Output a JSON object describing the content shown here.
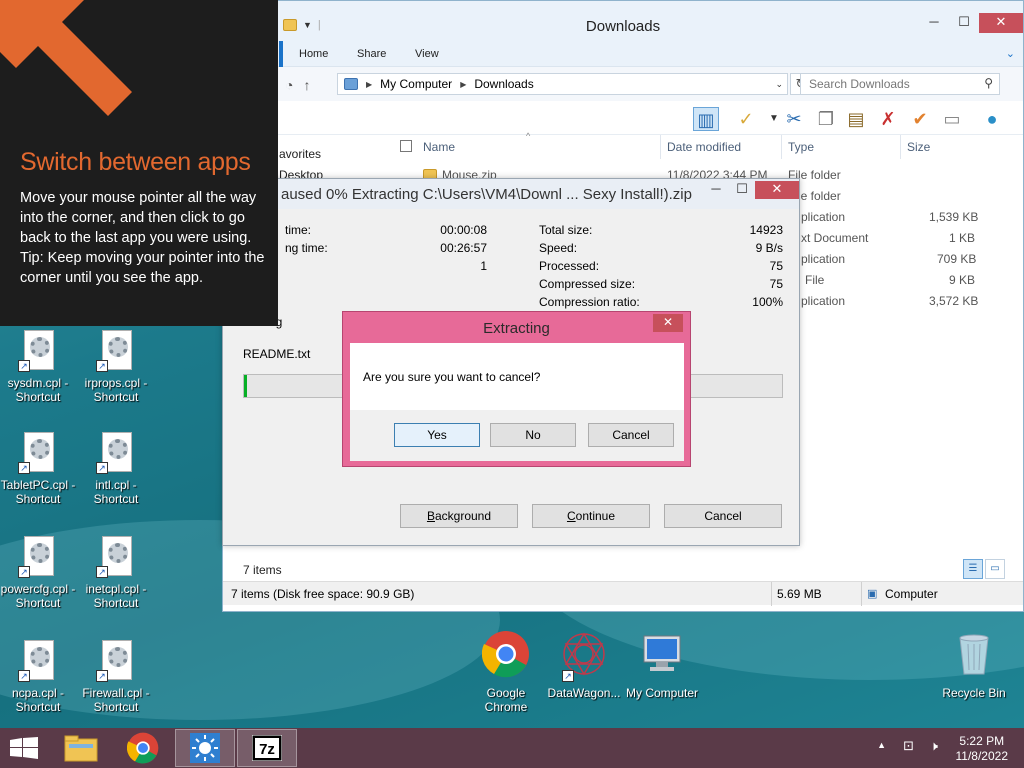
{
  "explorer": {
    "title": "Downloads",
    "tabs": [
      "Home",
      "Share",
      "View"
    ],
    "breadcrumb": [
      "My Computer",
      "Downloads"
    ],
    "search_placeholder": "Search Downloads",
    "columns": [
      "Name",
      "Date modified",
      "Type",
      "Size"
    ],
    "nav_pane": [
      "avorites",
      "Desktop"
    ],
    "rows": [
      {
        "name": "Mouse.zip",
        "date": "11/8/2022 3:44 PM",
        "type": "File folder",
        "size": ""
      },
      {
        "name": "",
        "date": "",
        "type": "File folder",
        "size": ""
      },
      {
        "name": "",
        "date": "",
        "type": "plication",
        "size": "1,539 KB"
      },
      {
        "name": "",
        "date": "",
        "type": "xt Document",
        "size": "1 KB"
      },
      {
        "name": "",
        "date": "",
        "type": "plication",
        "size": "709 KB"
      },
      {
        "name": "",
        "date": "",
        "type": "File",
        "size": "9 KB"
      },
      {
        "name": "",
        "date": "",
        "type": "plication",
        "size": "3,572 KB"
      }
    ],
    "item_count": "7 items",
    "status_left": "7 items (Disk free space: 90.9 GB)",
    "status_size": "5.69 MB",
    "status_location": "Computer"
  },
  "zip": {
    "title": "aused 0% Extracting C:\\Users\\VM4\\Downl ... Sexy Install!).zip",
    "left_stats": [
      {
        "label": "time:",
        "value": "00:00:08"
      },
      {
        "label": "ng time:",
        "value": "00:26:57"
      },
      {
        "label": "",
        "value": "1"
      }
    ],
    "right_stats": [
      {
        "label": "Total size:",
        "value": "14923"
      },
      {
        "label": "Speed:",
        "value": "9 B/s"
      },
      {
        "label": "Processed:",
        "value": "75"
      },
      {
        "label": "Compressed size:",
        "value": "75"
      },
      {
        "label": "Compression ratio:",
        "value": "100%"
      }
    ],
    "partial_label": "ng",
    "current_file": "README.txt",
    "progress": 0.005,
    "buttons": {
      "background": "Background",
      "continue": "Continue",
      "cancel": "Cancel"
    }
  },
  "confirm": {
    "title": "Extracting",
    "message": "Are you sure you want to cancel?",
    "buttons": {
      "yes": "Yes",
      "no": "No",
      "cancel": "Cancel"
    }
  },
  "tip": {
    "heading": "Switch between apps",
    "body": "Move your mouse pointer all the way into the corner, and then click to go back to the last app you were using.",
    "hint": "Tip: Keep moving your pointer into the corner until you see the app."
  },
  "desktop_icons": [
    {
      "label": "sysdm.cpl - Shortcut",
      "icon": "settings-file-icon"
    },
    {
      "label": "irprops.cpl - Shortcut",
      "icon": "settings-file-icon"
    },
    {
      "label": "TabletPC.cpl - Shortcut",
      "icon": "settings-file-icon"
    },
    {
      "label": "intl.cpl - Shortcut",
      "icon": "settings-file-icon"
    },
    {
      "label": "powercfg.cpl - Shortcut",
      "icon": "settings-file-icon"
    },
    {
      "label": "inetcpl.cpl - Shortcut",
      "icon": "settings-file-icon"
    },
    {
      "label": "ncpa.cpl - Shortcut",
      "icon": "settings-file-icon"
    },
    {
      "label": "Firewall.cpl - Shortcut",
      "icon": "settings-file-icon"
    },
    {
      "label": "Google Chrome",
      "icon": "chrome-icon"
    },
    {
      "label": "DataWagon...",
      "icon": "datawagon-icon"
    },
    {
      "label": "My Computer",
      "icon": "computer-icon"
    },
    {
      "label": "Recycle Bin",
      "icon": "recycle-bin-icon"
    }
  ],
  "taskbar": {
    "apps": [
      "file-explorer-icon",
      "chrome-icon",
      "sun-app-icon",
      "7zip-icon"
    ],
    "time": "5:22 PM",
    "date": "11/8/2022"
  },
  "colors": {
    "accent_orange": "#e2682f",
    "dialog_pink": "#e76a98",
    "close_red": "#c7505b",
    "taskbar": "#5a3a48"
  }
}
